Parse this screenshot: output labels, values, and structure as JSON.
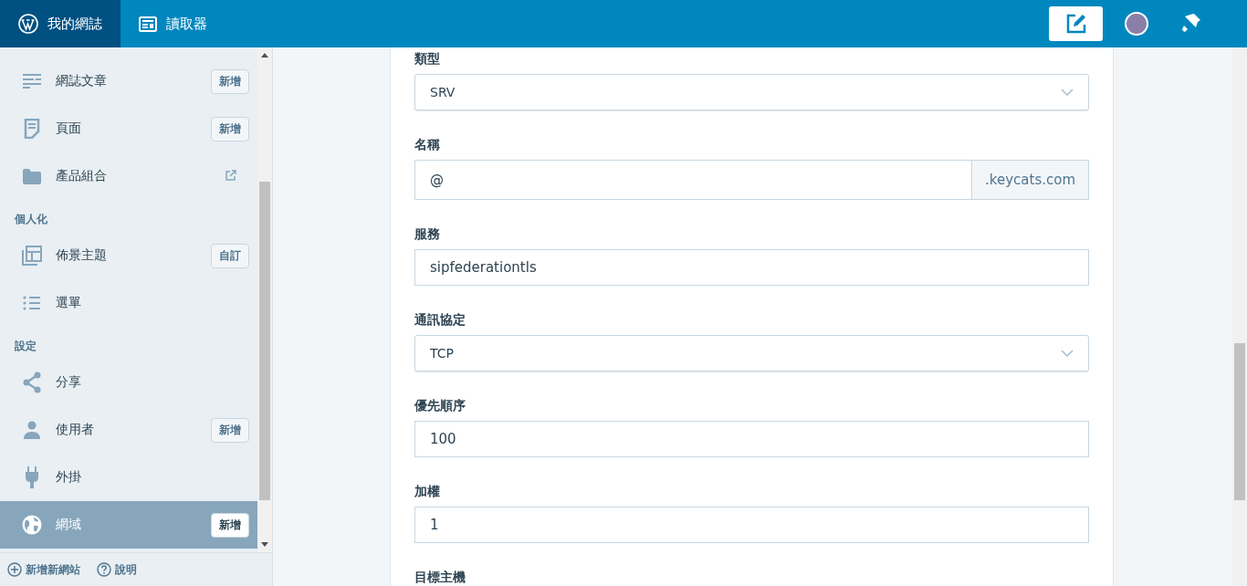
{
  "masterbar": {
    "my_site": {
      "label": "我的網誌",
      "selected": true
    },
    "reader": {
      "label": "讀取器",
      "selected": false
    }
  },
  "sidebar": {
    "items": [
      {
        "kind": "item",
        "label": "網誌文章",
        "action": "新增",
        "external": false,
        "selected": false
      },
      {
        "kind": "item",
        "label": "頁面",
        "action": "新增",
        "external": false,
        "selected": false
      },
      {
        "kind": "item",
        "label": "產品組合",
        "external": true,
        "selected": false
      },
      {
        "kind": "header",
        "label": "個人化"
      },
      {
        "kind": "item",
        "label": "佈景主題",
        "action": "自訂",
        "external": false,
        "selected": false
      },
      {
        "kind": "item",
        "label": "選單",
        "external": false,
        "selected": false
      },
      {
        "kind": "header",
        "label": "設定"
      },
      {
        "kind": "item",
        "label": "分享",
        "external": false,
        "selected": false
      },
      {
        "kind": "item",
        "label": "使用者",
        "action": "新增",
        "external": false,
        "selected": false
      },
      {
        "kind": "item",
        "label": "外掛",
        "external": false,
        "selected": false
      },
      {
        "kind": "item",
        "label": "網域",
        "action": "新增",
        "external": false,
        "selected": true
      }
    ],
    "footer": [
      {
        "label": "新增新網站"
      },
      {
        "label": "說明"
      }
    ]
  },
  "form": {
    "fields": [
      {
        "kind": "select",
        "label": "類型",
        "value": "SRV"
      },
      {
        "kind": "suffix",
        "label": "名稱",
        "value": "@",
        "suffix": ".keycats.com"
      },
      {
        "kind": "text",
        "label": "服務",
        "value": "sipfederationtls"
      },
      {
        "kind": "select",
        "label": "通訊協定",
        "value": "TCP"
      },
      {
        "kind": "text",
        "label": "優先順序",
        "value": "100"
      },
      {
        "kind": "text",
        "label": "加權",
        "value": "1"
      },
      {
        "kind": "label",
        "label": "目標主機"
      }
    ]
  }
}
